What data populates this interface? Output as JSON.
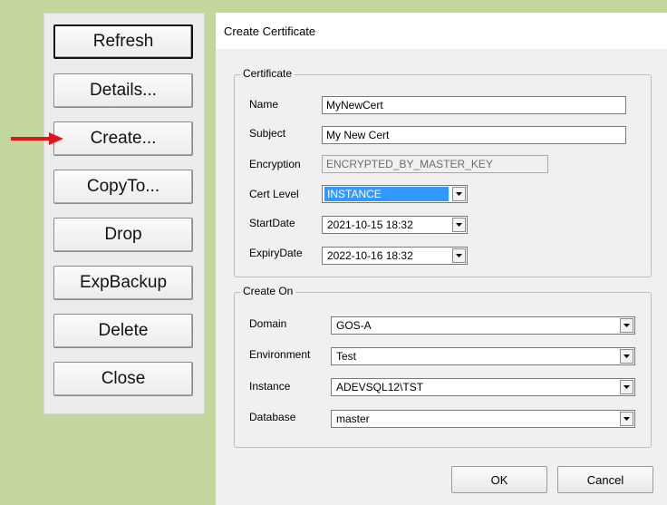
{
  "side_buttons": {
    "refresh": "Refresh",
    "details": "Details...",
    "create": "Create...",
    "copyto": "CopyTo...",
    "drop": "Drop",
    "expbackup": "ExpBackup",
    "delete": "Delete",
    "close": "Close"
  },
  "dialog": {
    "title": "Create Certificate",
    "certificate": {
      "group_label": "Certificate",
      "name_label": "Name",
      "name_value": "MyNewCert",
      "subject_label": "Subject",
      "subject_value": "My New Cert",
      "encryption_label": "Encryption",
      "encryption_value": "ENCRYPTED_BY_MASTER_KEY",
      "cert_level_label": "Cert Level",
      "cert_level_value": "INSTANCE",
      "startdate_label": "StartDate",
      "startdate_value": "2021-10-15 18:32",
      "expirydate_label": "ExpiryDate",
      "expirydate_value": "2022-10-16 18:32"
    },
    "create_on": {
      "group_label": "Create On",
      "domain_label": "Domain",
      "domain_value": "GOS-A",
      "environment_label": "Environment",
      "environment_value": "Test",
      "instance_label": "Instance",
      "instance_value": "ADEVSQL12\\TST",
      "database_label": "Database",
      "database_value": "master"
    },
    "ok_label": "OK",
    "cancel_label": "Cancel"
  },
  "colors": {
    "background": "#c3d69b",
    "arrow": "#e0161d",
    "selection": "#3399ff"
  },
  "icons": {
    "arrow": "red-arrow-icon",
    "dropdown": "chevron-down-icon"
  }
}
